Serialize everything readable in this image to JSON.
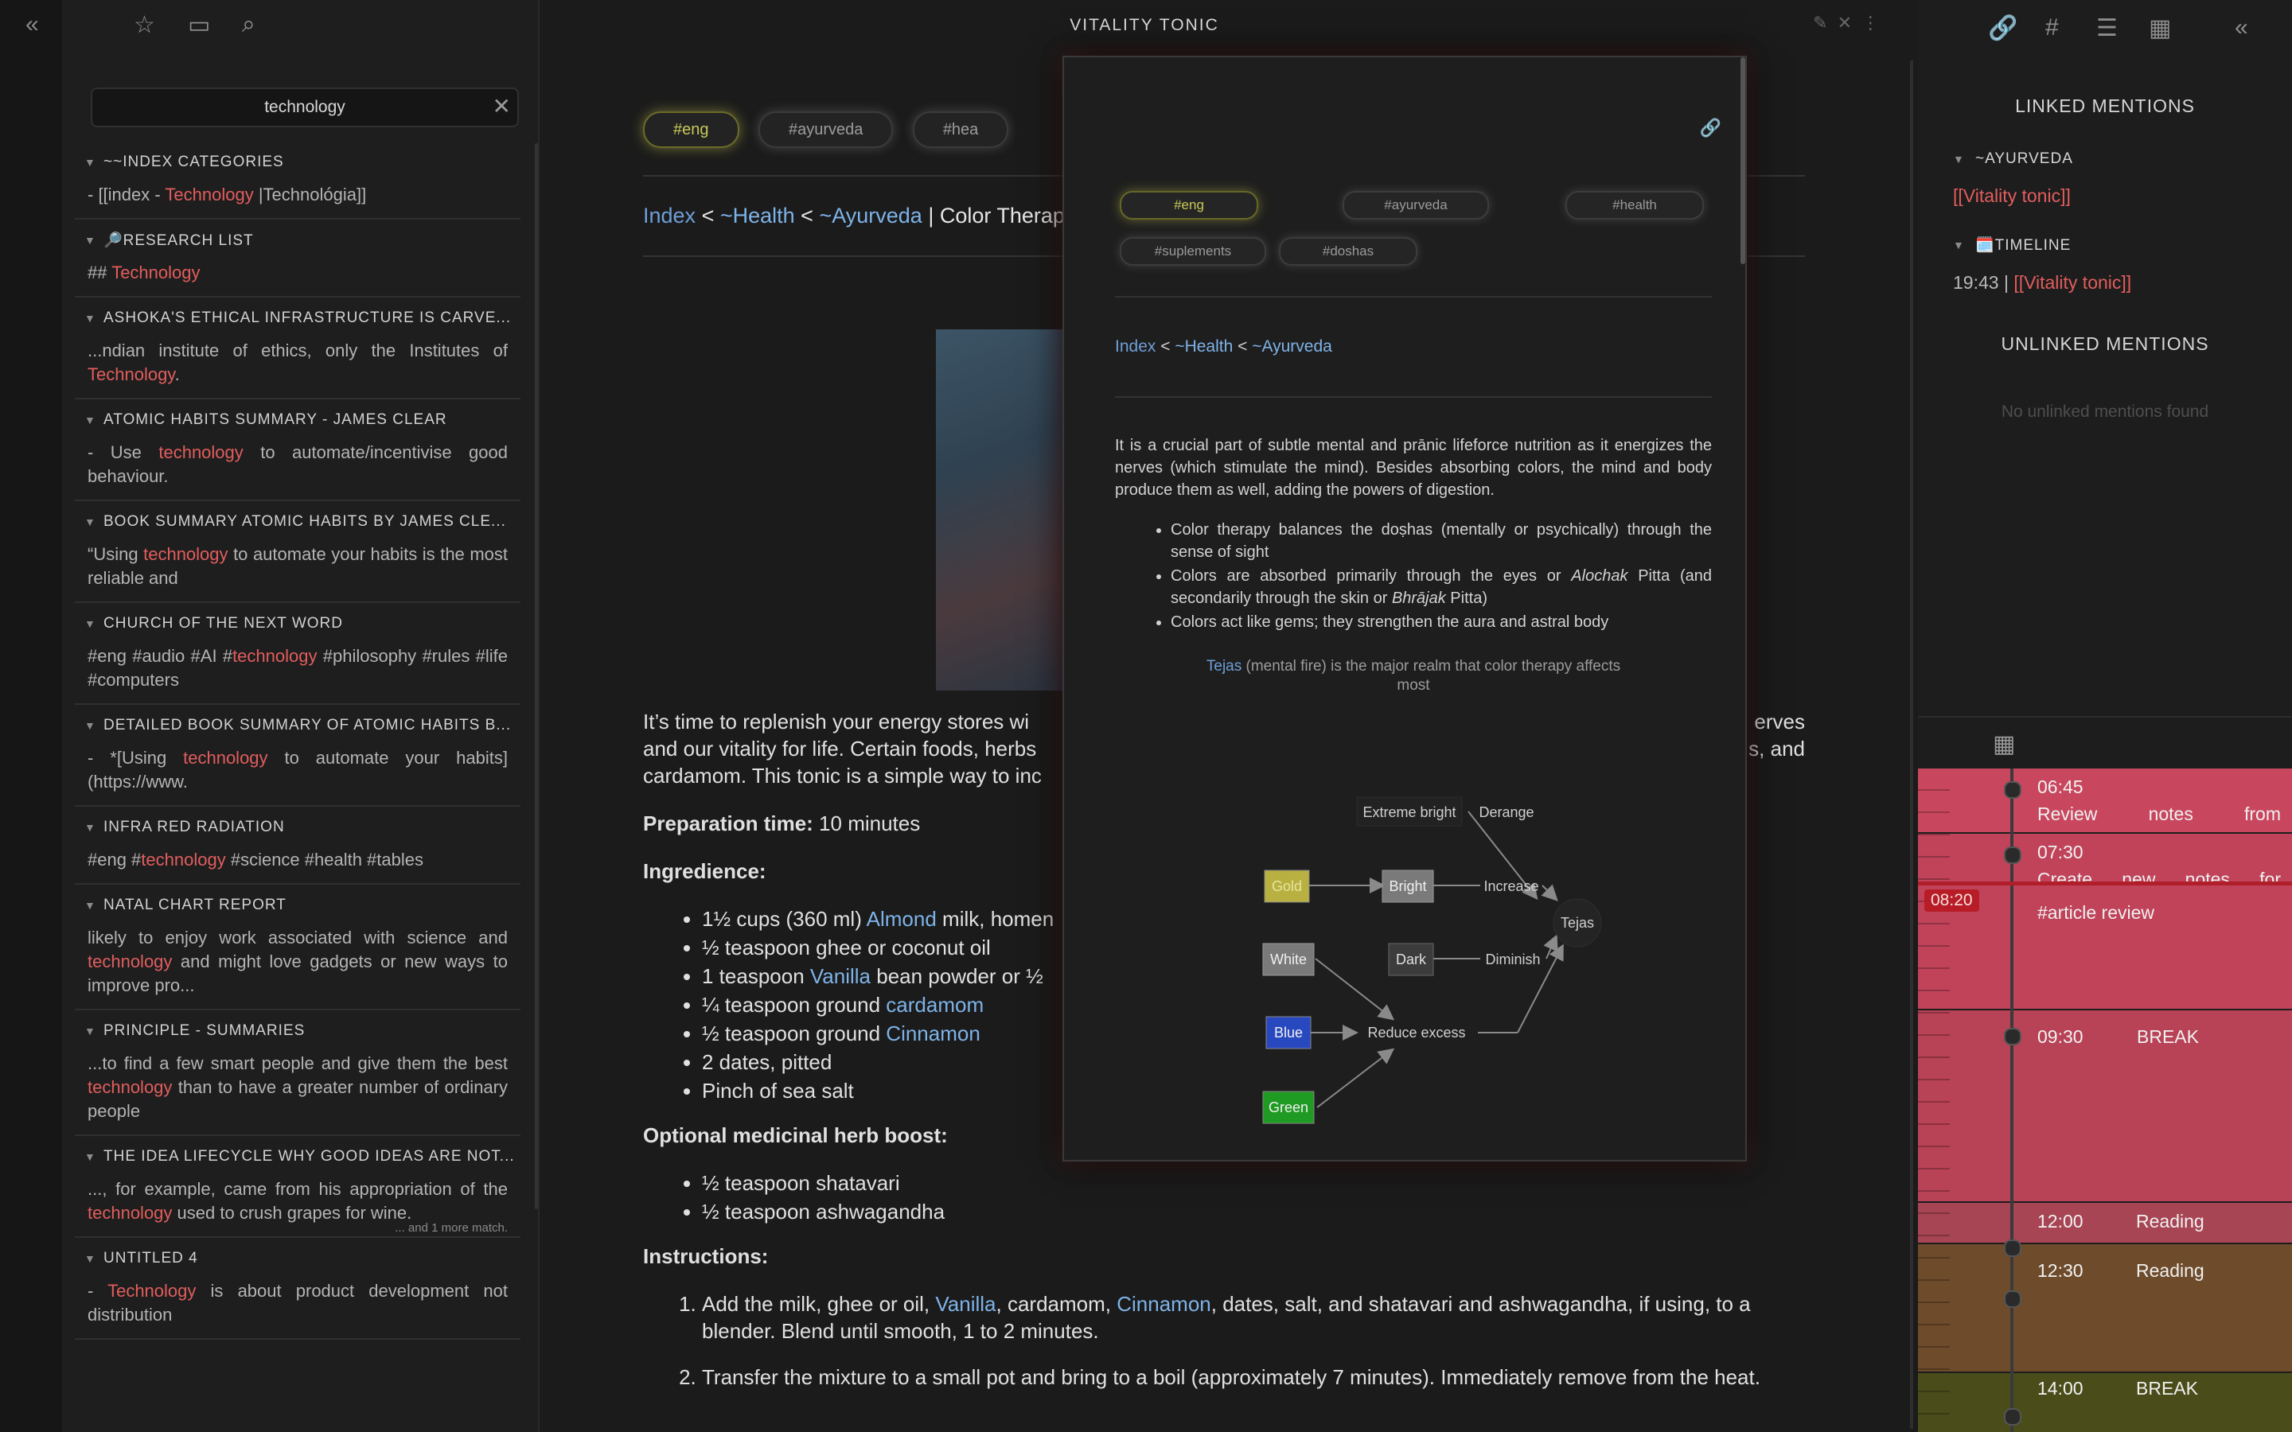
{
  "left_toolbar": {
    "collapse_icon": "double-chevron-left-icon"
  },
  "sidebar": {
    "search": {
      "value": "technology",
      "clear_label": "✕"
    },
    "results": [
      {
        "title": "~~INDEX CATEGORIES",
        "pre": "- [[index - ",
        "hl": "Technology",
        "post": " |Technológia]]",
        "more": ""
      },
      {
        "title": "🔎RESEARCH LIST",
        "pre": "## ",
        "hl": "Technology",
        "post": "",
        "more": ""
      },
      {
        "title": "ASHOKA'S ETHICAL INFRASTRUCTURE IS CARVE...",
        "pre": "...ndian institute of ethics, only the Institutes of ",
        "hl": "Technology",
        "post": ".",
        "more": ""
      },
      {
        "title": "ATOMIC HABITS SUMMARY - JAMES CLEAR",
        "pre": "-  Use ",
        "hl": "technology",
        "post": " to automate/incentivise good behaviour.",
        "more": ""
      },
      {
        "title": "BOOK SUMMARY ATOMIC HABITS BY JAMES CLE...",
        "pre": "“Using ",
        "hl": "technology",
        "post": " to automate your habits is the most reliable and",
        "more": ""
      },
      {
        "title": "CHURCH OF THE NEXT WORD",
        "pre": "#eng   #audio   #AI   #",
        "hl": "technology",
        "post": "   #philosophy #rules #life #computers",
        "more": ""
      },
      {
        "title": "DETAILED BOOK SUMMARY OF ATOMIC HABITS B...",
        "pre": "-   *[Using ",
        "hl": "technology",
        "post": " to automate your habits](https://www.",
        "more": ""
      },
      {
        "title": "INFRA RED RADIATION",
        "pre": "#eng #",
        "hl": "technology",
        "post": " #science #health #tables",
        "more": ""
      },
      {
        "title": "NATAL CHART REPORT",
        "pre": "likely to enjoy work associated with science and ",
        "hl": "technology",
        "post": " and might love gadgets or new ways to improve pro...",
        "more": ""
      },
      {
        "title": "PRINCIPLE - SUMMARIES",
        "pre": "...to find a few smart people and give them the best ",
        "hl": "technology",
        "post": " than to have a greater number of ordinary people",
        "more": ""
      },
      {
        "title": "THE IDEA LIFECYCLE WHY GOOD IDEAS ARE NOT...",
        "pre": "..., for example, came from his appropriation of the ",
        "hl": "technology",
        "post": " used to crush grapes for wine.",
        "more": "... and 1 more match."
      },
      {
        "title": "UNTITLED 4",
        "pre": "- ",
        "hl": "Technology",
        "post": " is about product development not distribution",
        "more": ""
      }
    ]
  },
  "main": {
    "title": "VITALITY TONIC",
    "tags": [
      "#eng",
      "#ayurveda",
      "#hea"
    ],
    "breadcrumb": {
      "a": "Index",
      "sep1": " < ",
      "b": "~Health",
      "sep2": " < ",
      "c": "~Ayurveda",
      "sep3": " | ",
      "d": "Color Therap"
    },
    "intro": {
      "l1": "It’s time to replenish your energy stores wi",
      "r1": "erves",
      "l2": "and our vitality for life. Certain foods, herbs",
      "r2": "s, and",
      "l3": "cardamom. This tonic is a simple way to inc"
    },
    "prep_label": "Preparation time:",
    "prep_value": " 10 minutes",
    "ingredients_label": "Ingredience:",
    "ingredients": [
      {
        "pre": "1½ cups (360 ml) ",
        "link": "Almond",
        "post": " milk, homen"
      },
      {
        "pre": "½ teaspoon ghee or coconut oil",
        "link": "",
        "post": ""
      },
      {
        "pre": "1 teaspoon ",
        "link": "Vanilla",
        "post": " bean powder or ½"
      },
      {
        "pre": "¼ teaspoon ground ",
        "link": "cardamom",
        "post": ""
      },
      {
        "pre": "½ teaspoon ground ",
        "link": "Cinnamon",
        "post": ""
      },
      {
        "pre": "2 dates, pitted",
        "link": "",
        "post": ""
      },
      {
        "pre": "Pinch of sea salt",
        "link": "",
        "post": ""
      }
    ],
    "herb_label": "Optional medicinal herb boost:",
    "herbs": [
      "½ teaspoon shatavari",
      "½ teaspoon ashwagandha"
    ],
    "instructions_label": "Instructions:",
    "steps": [
      {
        "a": "Add the milk, ghee or oil, ",
        "l1": "Vanilla",
        "b": ", cardamom, ",
        "l2": "Cinnamon",
        "c": ", dates, salt, and shatavari and ashwagandha, if using, to a blender. Blend until smooth, 1 to 2 minutes."
      },
      {
        "a": "Transfer the mixture to a small pot and bring to a boil (approximately 7 minutes). Immediately remove from the heat.",
        "l1": "",
        "b": "",
        "l2": "",
        "c": ""
      }
    ]
  },
  "preview": {
    "tags": [
      "#eng",
      "#ayurveda",
      "#health",
      "#suplements",
      "#doshas"
    ],
    "breadcrumb": {
      "a": "Index",
      "sep1": " < ",
      "b": "~Health",
      "sep2": " < ",
      "c": "~Ayurveda"
    },
    "para": "It is a crucial part of subtle mental and prānic lifeforce nutrition as it ener­gizes the nerves (which stimulate the mind). Besides absorbing colors, the mind and body produce them as well, adding the powers of digestion.",
    "bullets": [
      {
        "pre": "Color therapy balances the doṣhas (mentally or psychically) through the sense of sight",
        "em1": "",
        "mid": "",
        "em2": "",
        "post": ""
      },
      {
        "pre": "Colors are absorbed primarily through the eyes or ",
        "em1": "Alochak",
        "mid": " Pitta (and secondarily through the skin or ",
        "em2": "Bhrājak",
        "post": " Pitta)"
      },
      {
        "pre": "Colors act like gems; they strengthen the aura and astral body",
        "em1": "",
        "mid": "",
        "em2": "",
        "post": ""
      }
    ],
    "caption_link": "Tejas",
    "caption_rest": " (mental fire) is the major realm that color therapy affects most",
    "diagram": {
      "nodes": [
        "Extreme bright",
        "Derange",
        "Gold",
        "Bright",
        "Increase",
        "Tejas",
        "White",
        "Dark",
        "Diminish",
        "Blue",
        "Reduce excess",
        "Green"
      ],
      "colors": {
        "gold": "#b8b040",
        "white": "#7a7a7a",
        "blue": "#2848c0",
        "green": "#1f9a22",
        "bright": "#7a7a7a",
        "dark": "#3c3c3c"
      }
    }
  },
  "right_panel": {
    "linked_title": "LINKED MENTIONS",
    "groups": [
      {
        "title": "~AYURVEDA",
        "time": "",
        "link": "[[Vitality tonic]]"
      },
      {
        "title": "🗓️TIMELINE",
        "time": "19:43 | ",
        "link": "[[Vitality tonic]]"
      }
    ],
    "unlinked_title": "UNLINKED MENTIONS",
    "no_unlinked": "No unlinked mentions found",
    "now_time": "08:20",
    "schedule": [
      {
        "time": "06:45",
        "title": "Review notes from",
        "color": "#c9475e"
      },
      {
        "time": "07:30",
        "title": "Create new notes for",
        "title2": "#article review",
        "color": "#c0435a"
      },
      {
        "time": "09:30",
        "title": "BREAK",
        "color": "#b84256"
      },
      {
        "time": "12:00",
        "title": "Reading",
        "color": "#a84554"
      },
      {
        "time": "12:30",
        "title": "Reading",
        "color": "#6e4b2a"
      },
      {
        "time": "14:00",
        "title": "BREAK",
        "color": "#4a4d1a"
      }
    ]
  }
}
